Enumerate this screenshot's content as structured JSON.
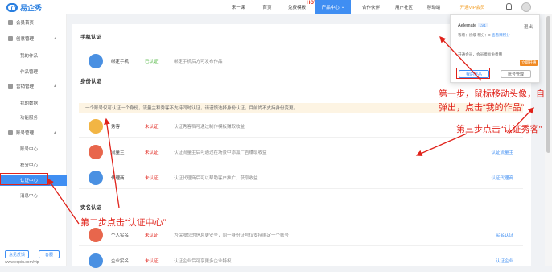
{
  "logo": {
    "text": "易企秀"
  },
  "nav": {
    "items": [
      "来一课",
      "首页",
      "免费模板",
      "产品中心",
      "合作伙伴",
      "用户社区",
      "移动端",
      "开通VIP会员"
    ],
    "hot": "HOT",
    "product_caret": "⌄"
  },
  "sidebar": {
    "g1": "会员首页",
    "g2": "创意管理",
    "g2_items": [
      "我的作品",
      "作品管理"
    ],
    "g3": "营销管理",
    "g3_items": [
      "我的数据",
      "功能服务"
    ],
    "g4": "账号管理",
    "g4_items": [
      "账号中心",
      "积分中心",
      "认证中心",
      "消息中心"
    ],
    "btn_left": "意见反馈",
    "btn_right": "客服",
    "watermark": "www.eqxiu.com/vip"
  },
  "main": {
    "phone_title": "手机认证",
    "phone_row": {
      "name": "绑定手机",
      "status": "已认证",
      "desc": "绑定手机后方可发布作品"
    },
    "identity_title": "身份认证",
    "notice": "一个账号仅可认证一个身份，流量主和秀客不支持同时认证，请谨慎选择身份认证，目前尚不支持身份变更。",
    "identity_rows": [
      {
        "name": "秀客",
        "status": "未认证",
        "desc": "认证秀客后可通过制作模板赚取收益",
        "action": ""
      },
      {
        "name": "流量主",
        "status": "未认证",
        "desc": "认证流量主后可通过在场景中添加广告赚取收益",
        "action": "认证流量主"
      },
      {
        "name": "代理商",
        "status": "未认证",
        "desc": "认证代理商后可以帮助客户推广，获取收益",
        "action": "认证代理商"
      }
    ],
    "realname_title": "实名认证",
    "realname_rows": [
      {
        "name": "个人实名",
        "status": "未认证",
        "desc": "为保障您的信息更安全，同一身份证号仅支持绑定一个账号",
        "action": "实名认证"
      },
      {
        "name": "企业实名",
        "status": "未认证",
        "desc": "认证企业后可享更多企业特权",
        "action": "认证企业"
      }
    ]
  },
  "popup": {
    "name": "Aelemate",
    "level": "LV1",
    "logout": "退出",
    "line1": "等级：初级  积分：0",
    "line1_link": "查看赚积分",
    "line2": "开通会员，会员模板免费用",
    "line3": "立即开通",
    "btn_works": "我的作品",
    "btn_account": "账号管理"
  },
  "annotations": {
    "step1a": "第一步，鼠标移动头像，自动",
    "step1b": "弹出，点击“我的作品”",
    "step2": "第二步点击“认证中心”",
    "step3": "第三步点击“认证秀客”"
  },
  "colors": {
    "brand": "#3f8ef2",
    "annotation": "#e0221a",
    "verified": "#52b744",
    "unverified": "#e0221a"
  }
}
